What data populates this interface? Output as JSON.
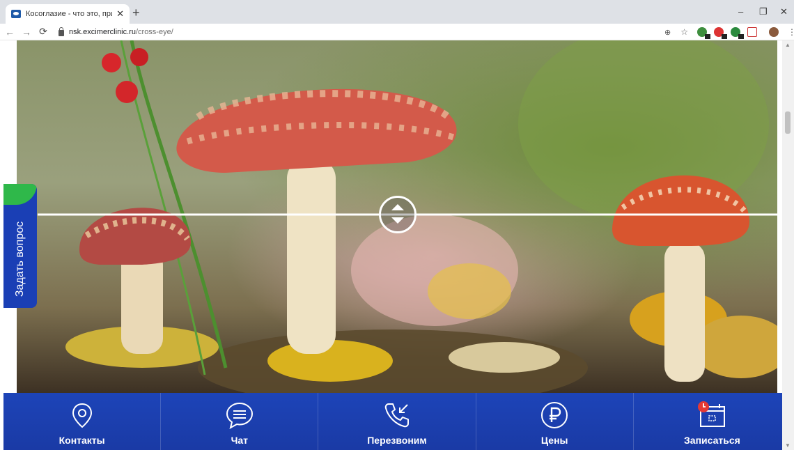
{
  "browser": {
    "tab_title": "Косоглазие - что это, причины",
    "tab_close": "✕",
    "new_tab": "+",
    "url_host": "nsk.excimercliniс.ru",
    "url_path": "/cross-eye/",
    "window_min": "–",
    "window_max": "❐",
    "window_close": "✕"
  },
  "page": {
    "ask_question": "Задать вопрос"
  },
  "bottom_bar": {
    "items": [
      {
        "label": "Контакты",
        "icon": "location-pin-icon"
      },
      {
        "label": "Чат",
        "icon": "chat-bubble-icon"
      },
      {
        "label": "Перезвоним",
        "icon": "phone-callback-icon"
      },
      {
        "label": "Цены",
        "icon": "ruble-icon"
      },
      {
        "label": "Записаться",
        "icon": "calendar-icon"
      }
    ]
  },
  "colors": {
    "bar_blue": "#1d44b8",
    "accent_green": "#2fb84a",
    "badge_red": "#e53935"
  }
}
